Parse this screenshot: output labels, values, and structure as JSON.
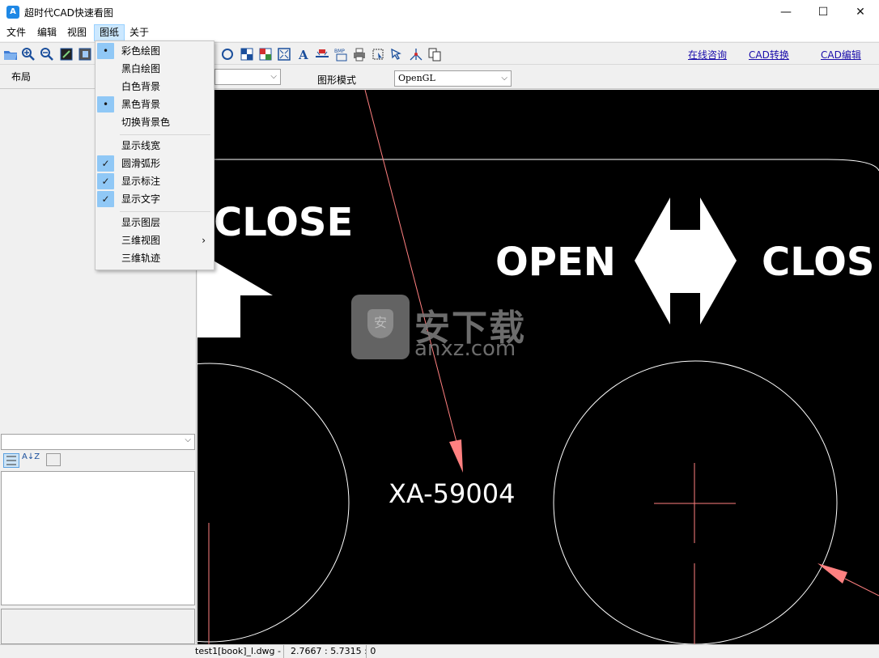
{
  "window": {
    "title": "超时代CAD快速看图",
    "app_icon_glyph": "A"
  },
  "window_controls": {
    "minimize": "—",
    "maximize": "☐",
    "close": "✕"
  },
  "menu": {
    "items": [
      "文件",
      "编辑",
      "视图",
      "图纸",
      "关于"
    ],
    "active_index": 3
  },
  "toolbar": {
    "links": [
      "在线咨询",
      "CAD转换",
      "CAD编辑"
    ]
  },
  "row2": {
    "layout_label": "布局",
    "graphics_mode_label": "图形模式",
    "graphics_mode_value": "OpenGL"
  },
  "dropdown": {
    "items": [
      {
        "label": "彩色绘图",
        "mark": "•"
      },
      {
        "label": "黑白绘图",
        "mark": ""
      },
      {
        "label": "白色背景",
        "mark": ""
      },
      {
        "label": "黑色背景",
        "mark": "•"
      },
      {
        "label": "切换背景色",
        "mark": ""
      },
      {
        "label": "显示线宽",
        "mark": ""
      },
      {
        "label": "圆滑弧形",
        "mark": "✓"
      },
      {
        "label": "显示标注",
        "mark": "✓"
      },
      {
        "label": "显示文字",
        "mark": "✓"
      },
      {
        "label": "显示图层",
        "mark": ""
      },
      {
        "label": "三维视图",
        "mark": "",
        "submenu": "›"
      },
      {
        "label": "三维轨迹",
        "mark": ""
      }
    ]
  },
  "drawing": {
    "texts": {
      "close_left": "CLOSE",
      "open": "OPEN",
      "close_right": "CLOS",
      "part_no": "XA-59004"
    },
    "colors": {
      "background": "#000000",
      "lines": "#ffffff",
      "red": "#ff8080"
    }
  },
  "watermark": {
    "cn": "安下载",
    "url": "anxz.com",
    "shield_glyph": "安"
  },
  "left_panel": {
    "sort_icon": "A↓Z"
  },
  "status": {
    "file": "test1[book]_l.dwg -",
    "coords": "2.7667 : 5.7315 : 0"
  }
}
